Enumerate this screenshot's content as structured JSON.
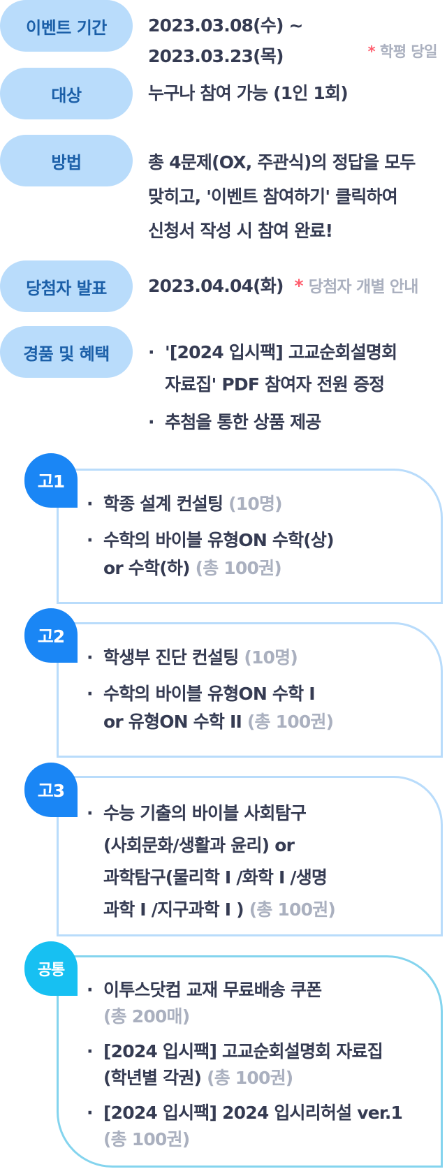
{
  "event_period": {
    "label": "이벤트 기간",
    "value": "2023.03.08(수) ~ 2023.03.23(목)",
    "note_star": "*",
    "note": "학평 당일"
  },
  "target": {
    "label": "대상",
    "value": "누구나 참여 가능 (1인 1회)"
  },
  "method": {
    "label": "방법",
    "lines": [
      "총 4문제(OX, 주관식)의 정답을 모두",
      "맞히고, '이벤트 참여하기' 클릭하여",
      "신청서 작성 시 참여 완료!"
    ]
  },
  "announce": {
    "label": "당첨자 발표",
    "value": "2023.04.04(화)",
    "note_star": "*",
    "note": "당첨자 개별 안내"
  },
  "prize": {
    "label": "경품 및 혜택",
    "items": [
      {
        "lines": [
          "'[2024 입시팩] 고교순회설명회",
          "자료집' PDF 참여자 전원 증정"
        ]
      },
      {
        "lines": [
          "추첨을 통한 상품 제공"
        ]
      }
    ]
  },
  "grades": [
    {
      "tag": "고1",
      "items": [
        {
          "text": "학종 설계 컨설팅",
          "count": "(10명)"
        },
        {
          "text": "수학의 바이블 유형ON 수학(상)",
          "text2": "or 수학(하)",
          "count": "(총 100권)"
        }
      ]
    },
    {
      "tag": "고2",
      "items": [
        {
          "text": "학생부 진단 컨설팅",
          "count": "(10명)"
        },
        {
          "text": "수학의 바이블 유형ON 수학 I",
          "text2": "or 유형ON 수학 II",
          "count": "(총 100권)"
        }
      ]
    },
    {
      "tag": "고3",
      "items": [
        {
          "text": "수능 기출의 바이블 사회탐구",
          "text2": "(사회문화/생활과 윤리) or",
          "text3": "과학탐구(물리학 I /화학 I /생명",
          "text4": "과학 I /지구과학 I )",
          "count": "(총 100권)"
        }
      ]
    },
    {
      "tag": "공통",
      "items": [
        {
          "text": "이투스닷컴 교재 무료배송 쿠폰",
          "count": "(총 200매)"
        },
        {
          "text": "[2024 입시팩] 고교순회설명회 자료집",
          "text2": "(학년별 각권)",
          "count": "(총 100권)"
        },
        {
          "text": "[2024 입시팩] 2024 입시리허설 ver.1",
          "count": "(총 100권)"
        }
      ]
    }
  ]
}
